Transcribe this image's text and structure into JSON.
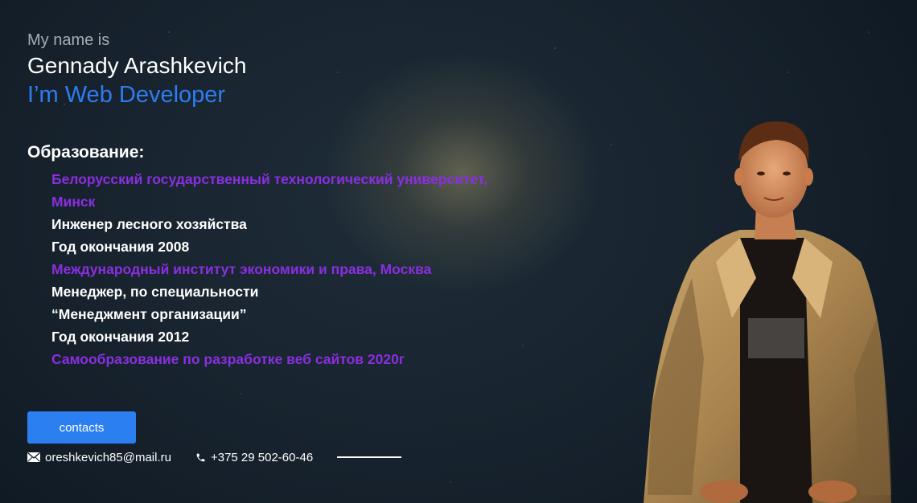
{
  "header": {
    "intro": "My name is",
    "name": "Gennady Arashkevich",
    "role": "I’m Web Developer"
  },
  "education": {
    "title": "Образование:",
    "items": [
      {
        "text": "Белорусский государственный технологический университет, Минск",
        "kind": "institution"
      },
      {
        "text": "Инженер лесного хозяйства",
        "kind": "info"
      },
      {
        "text": "Год окончания 2008",
        "kind": "info"
      },
      {
        "text": "Международный институт экономики и права, Москва",
        "kind": "institution"
      },
      {
        "text": "Менеджер, по специальности “Менеджмент организации”",
        "kind": "info"
      },
      {
        "text": "Год окончания 2012",
        "kind": "info"
      },
      {
        "text": "Самообразование по разработке веб сайтов 2020г",
        "kind": "institution"
      }
    ]
  },
  "contacts": {
    "button_label": "contacts",
    "email": "oreshkevich85@mail.ru",
    "email_icon": "envelope-icon",
    "phone": "+375 29 502-60-46",
    "phone_icon": "phone-icon"
  },
  "colors": {
    "accent_blue": "#2f7cf0",
    "institution_purple": "#8a2fe0",
    "button_blue": "#2b7ff1"
  }
}
